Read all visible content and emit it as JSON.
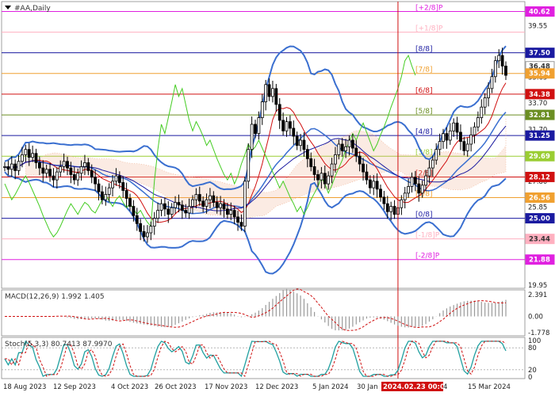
{
  "chart_data": [
    {
      "type": "candlestick",
      "title": "#AA,Daily",
      "x_labels": [
        "18 Aug 2023",
        "12 Sep 2023",
        "4 Oct 2023",
        "26 Oct 2023",
        "17 Nov 2023",
        "12 Dec 2023",
        "5 Jan 2024",
        "30 Jan",
        "2024.02.23 00:00",
        "4",
        "15 Mar 2024"
      ],
      "cursor_label": "2024.02.23 00:00",
      "ylim": [
        19.95,
        41.25
      ],
      "y_ticks": [
        "39.55",
        "37.50",
        "36.48",
        "35.94",
        "35.65",
        "34.38",
        "33.70",
        "32.81",
        "31.70",
        "31.25",
        "29.69",
        "28.12",
        "27.80",
        "26.56",
        "25.85",
        "25.00",
        "23.44",
        "21.88",
        "19.95"
      ],
      "price_badges": [
        {
          "label": "40.62",
          "value": 40.62,
          "color": "#e020e0"
        },
        {
          "label": "37.50",
          "value": 37.5,
          "color": "#1a1aa0"
        },
        {
          "label": "36.48",
          "value": 36.48,
          "color": "#ffffff"
        },
        {
          "label": "35.94",
          "value": 35.94,
          "color": "#f0a030"
        },
        {
          "label": "34.38",
          "value": 34.38,
          "color": "#d01010"
        },
        {
          "label": "32.81",
          "value": 32.81,
          "color": "#6b8e23"
        },
        {
          "label": "31.25",
          "value": 31.25,
          "color": "#1a1aa0"
        },
        {
          "label": "29.69",
          "value": 29.69,
          "color": "#9acd32"
        },
        {
          "label": "28.12",
          "value": 28.12,
          "color": "#d01010"
        },
        {
          "label": "26.56",
          "value": 26.56,
          "color": "#f0a030"
        },
        {
          "label": "25.00",
          "value": 25.0,
          "color": "#1a1aa0"
        },
        {
          "label": "23.44",
          "value": 23.44,
          "color": "#ffb0c0"
        },
        {
          "label": "21.88",
          "value": 21.88,
          "color": "#e020e0"
        }
      ],
      "murrey_levels": [
        {
          "label": "[+2/8]P",
          "value": 40.62,
          "color": "#e020e0"
        },
        {
          "label": "[+1/8]P",
          "value": 39.06,
          "color": "#ffb0c0"
        },
        {
          "label": "[8/8]",
          "value": 37.5,
          "color": "#1a1aa0"
        },
        {
          "label": "[7/8]",
          "value": 35.94,
          "color": "#f0a030"
        },
        {
          "label": "[6/8]",
          "value": 34.38,
          "color": "#d01010"
        },
        {
          "label": "[5/8]",
          "value": 32.81,
          "color": "#6b8e23"
        },
        {
          "label": "[4/8]",
          "value": 31.25,
          "color": "#1a1aa0"
        },
        {
          "label": "[3/8]",
          "value": 29.69,
          "color": "#9acd32"
        },
        {
          "label": "[2/8]",
          "value": 28.12,
          "color": "#d01010"
        },
        {
          "label": "[1/8]",
          "value": 26.56,
          "color": "#f0a030"
        },
        {
          "label": "[0/8]",
          "value": 25.0,
          "color": "#1a1aa0"
        },
        {
          "label": "[-1/8]P",
          "value": 23.44,
          "color": "#ffb0c0"
        },
        {
          "label": "[-2/8]P",
          "value": 21.88,
          "color": "#e020e0"
        }
      ],
      "ohlc_close": [
        28.9,
        28.7,
        29.1,
        28.6,
        29.3,
        29.8,
        30.2,
        29.6,
        29.9,
        29.2,
        28.8,
        28.4,
        28.7,
        28.2,
        27.9,
        28.5,
        28.9,
        29.3,
        28.8,
        28.3,
        27.9,
        28.4,
        28.9,
        29.2,
        28.6,
        28.1,
        27.6,
        27.0,
        26.4,
        26.8,
        27.3,
        27.8,
        28.2,
        27.7,
        27.1,
        26.5,
        25.9,
        25.2,
        24.6,
        24.0,
        23.6,
        23.9,
        24.4,
        25.0,
        25.6,
        26.1,
        25.7,
        25.3,
        25.8,
        26.2,
        26.0,
        25.6,
        25.4,
        25.9,
        26.4,
        26.8,
        26.3,
        25.9,
        26.4,
        26.7,
        26.2,
        25.8,
        26.1,
        25.7,
        25.3,
        25.6,
        25.1,
        24.7,
        24.4,
        27.8,
        30.2,
        32.1,
        31.4,
        32.6,
        33.8,
        35.1,
        34.2,
        34.8,
        33.6,
        32.4,
        31.6,
        32.3,
        31.8,
        31.2,
        30.5,
        30.9,
        30.2,
        29.5,
        28.9,
        28.3,
        27.9,
        28.4,
        27.6,
        28.2,
        29.1,
        29.8,
        30.6,
        30.1,
        30.4,
        30.9,
        30.3,
        29.7,
        29.1,
        28.5,
        27.9,
        27.3,
        27.8,
        27.2,
        26.6,
        26.1,
        25.5,
        25.9,
        25.3,
        25.8,
        26.4,
        26.9,
        27.4,
        28.1,
        27.6,
        26.9,
        27.5,
        28.2,
        28.8,
        29.4,
        30.2,
        30.8,
        31.4,
        30.9,
        31.6,
        32.2,
        31.5,
        30.8,
        30.1,
        30.6,
        31.3,
        31.9,
        32.6,
        33.4,
        34.1,
        34.8,
        35.7,
        36.9,
        37.3,
        36.5,
        35.8
      ]
    },
    {
      "type": "macd",
      "title": "MACD(12,26,9) 1.992 1.405",
      "params": "12,26,9",
      "value": 1.992,
      "signal": 1.405,
      "y_ticks": [
        "2.391",
        "0.00",
        "-1.778"
      ]
    },
    {
      "type": "stochastic",
      "title": "Stoch(5,3,3) 80.7413 87.9970",
      "params": "5,3,3",
      "k": 80.7413,
      "d": 87.997,
      "y_ticks": [
        "100",
        "80",
        "20",
        "0"
      ]
    }
  ],
  "colors": {
    "candle_bull": "#000000",
    "candle_bear": "#000000",
    "bollinger": "#3a6fd0",
    "tenkan": "#d01010",
    "kijun": "#1a1aa0",
    "chikou": "#44cc22",
    "cloud": "#f0b090",
    "macd_hist": "#999999",
    "macd_signal": "#d01010",
    "stoch_main": "#20a0a0",
    "stoch_signal": "#d01010",
    "cursor": "#d01010"
  }
}
